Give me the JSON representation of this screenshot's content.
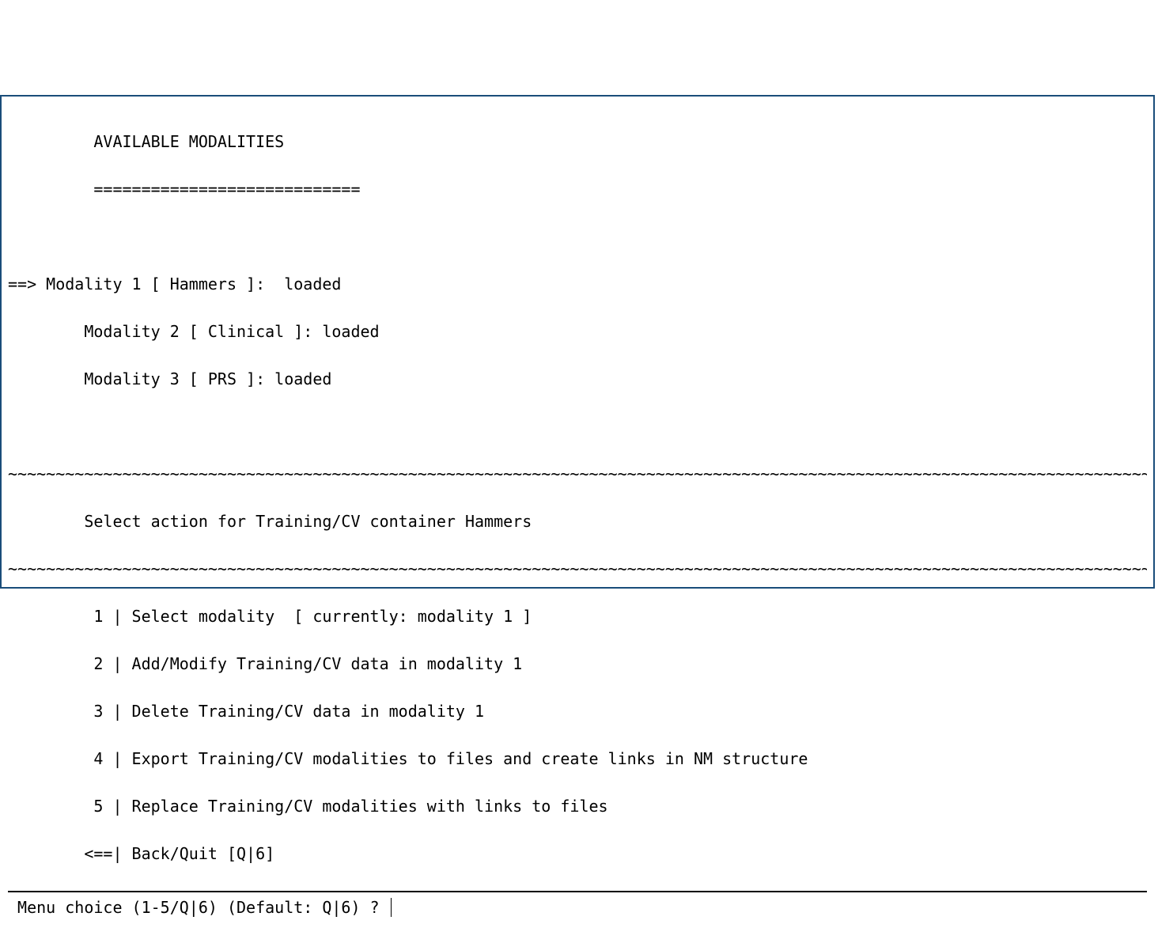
{
  "header": {
    "title": "         AVAILABLE MODALITIES",
    "underline": "         ============================"
  },
  "modalities": {
    "selected_marker": "==> ",
    "indent": "        ",
    "items": [
      "Modality 1 [ Hammers ]:  loaded",
      "Modality 2 [ Clinical ]: loaded",
      "Modality 3 [ PRS ]: loaded"
    ]
  },
  "section": {
    "wave": "~~~~~~~~~~~~~~~~~~~~~~~~~~~~~~~~~~~~~~~~~~~~~~~~~~~~~~~~~~~~~~~~~~~~~~~~~~~~~~~~~~~~~~~~~~~~~~~~~~~~~~~~~~~~~~~~~~~~~~~~",
    "title": "        Select action for Training/CV container Hammers"
  },
  "menu": {
    "indent": "        ",
    "items": [
      " 1 | Select modality  [ currently: modality 1 ]",
      " 2 | Add/Modify Training/CV data in modality 1",
      " 3 | Delete Training/CV data in modality 1",
      " 4 | Export Training/CV modalities to files and create links in NM structure",
      " 5 | Replace Training/CV modalities with links to files",
      "<==| Back/Quit [Q|6]"
    ]
  },
  "prompt": {
    "text": " Menu choice (1-5/Q|6) (Default: Q|6) ? "
  }
}
